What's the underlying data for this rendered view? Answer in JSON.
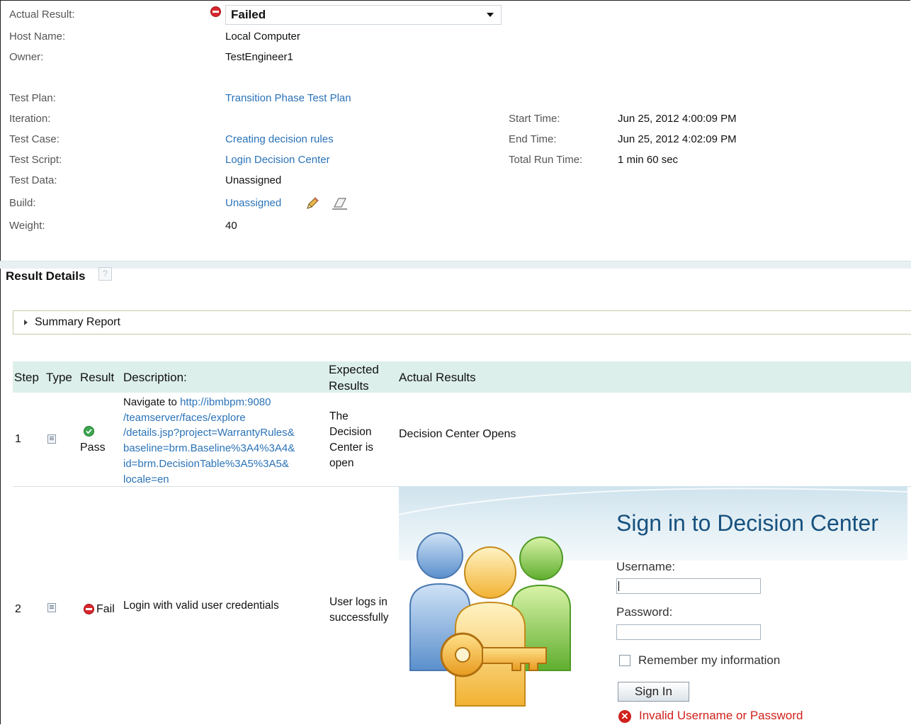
{
  "details": {
    "actual_result_label": "Actual Result:",
    "actual_result_value": "Failed",
    "host_label": "Host Name:",
    "host_value": "Local Computer",
    "owner_label": "Owner:",
    "owner_value": "TestEngineer1",
    "test_plan_label": "Test Plan:",
    "test_plan_value": "Transition Phase Test Plan",
    "iteration_label": "Iteration:",
    "test_case_label": "Test Case:",
    "test_case_value": "Creating decision rules",
    "test_script_label": "Test Script:",
    "test_script_value": "Login Decision Center",
    "test_data_label": "Test Data:",
    "test_data_value": "Unassigned",
    "build_label": "Build:",
    "build_value": "Unassigned",
    "weight_label": "Weight:",
    "weight_value": "40",
    "start_time_label": "Start Time:",
    "start_time_value": "Jun 25, 2012 4:00:09 PM",
    "end_time_label": "End Time:",
    "end_time_value": "Jun 25, 2012 4:02:09 PM",
    "total_run_label": "Total Run Time:",
    "total_run_value": "1 min 60 sec"
  },
  "result_details": {
    "heading": "Result Details",
    "help": "?",
    "summary_report": "Summary Report"
  },
  "table": {
    "headers": {
      "step": "Step",
      "type": "Type",
      "result": "Result",
      "description": "Description:",
      "expected_1": "Expected",
      "expected_2": "Results",
      "actual": "Actual Results"
    },
    "rows": [
      {
        "step": "1",
        "result": "Pass",
        "description_prefix": "Navigate to",
        "description_link": [
          "http://ibmbpm:9080",
          "/teamserver/faces/explore",
          "/details.jsp?project=WarrantyRules&",
          "baseline=brm.Baseline%3A4%3A4&",
          "id=brm.DecisionTable%3A5%3A5&",
          "locale=en"
        ],
        "expected": [
          "The",
          "Decision",
          "Center is",
          "open"
        ],
        "actual": "Decision Center Opens"
      },
      {
        "step": "2",
        "result": "Fail",
        "description": "Login with valid user credentials",
        "expected": [
          "User logs in",
          "successfully"
        ]
      }
    ]
  },
  "login_screenshot": {
    "title": "Sign in to Decision Center",
    "username_label": "Username:",
    "password_label": "Password:",
    "remember_label": "Remember my information",
    "sign_in": "Sign In",
    "error": "Invalid Username or Password"
  }
}
